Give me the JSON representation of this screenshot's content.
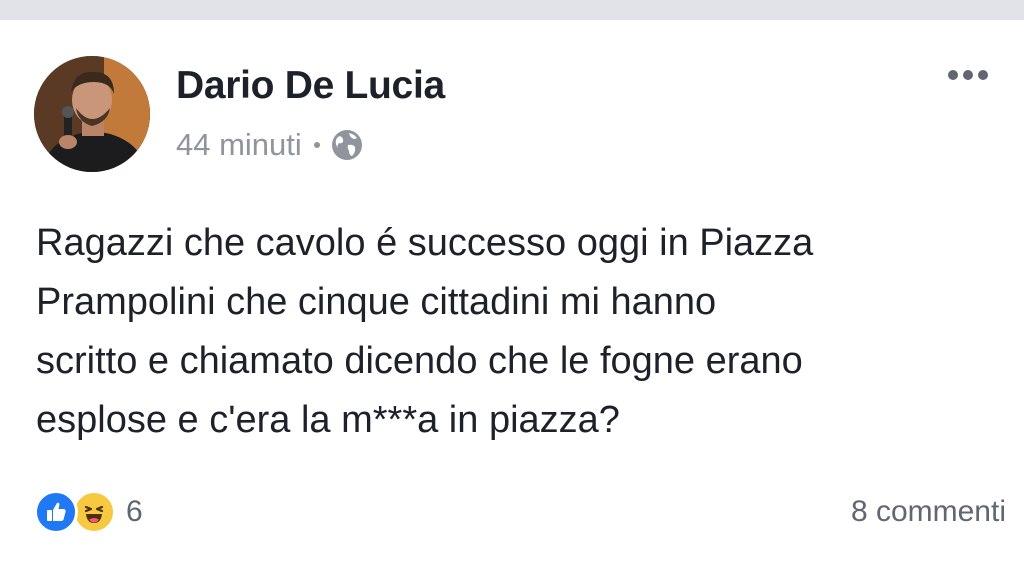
{
  "post": {
    "author": "Dario De Lucia",
    "timestamp": "44 minuti",
    "privacy_icon": "globe-icon",
    "more_icon": "more-options-icon",
    "text_lines": [
      "Ragazzi che cavolo é successo oggi in Piazza",
      "Prampolini che cinque cittadini mi hanno",
      "scritto e chiamato dicendo che le fogne erano",
      "esplose e c'era la m***a in piazza?"
    ],
    "reactions": {
      "icons": [
        "like-icon",
        "haha-icon"
      ],
      "count": "6"
    },
    "comments_label": "8 commenti"
  },
  "colors": {
    "top_bar": "#e1e3e8",
    "author_text": "#1d2129",
    "meta_text": "#90949c",
    "like_blue": "#2078f4",
    "haha_yellow": "#f7c940"
  }
}
